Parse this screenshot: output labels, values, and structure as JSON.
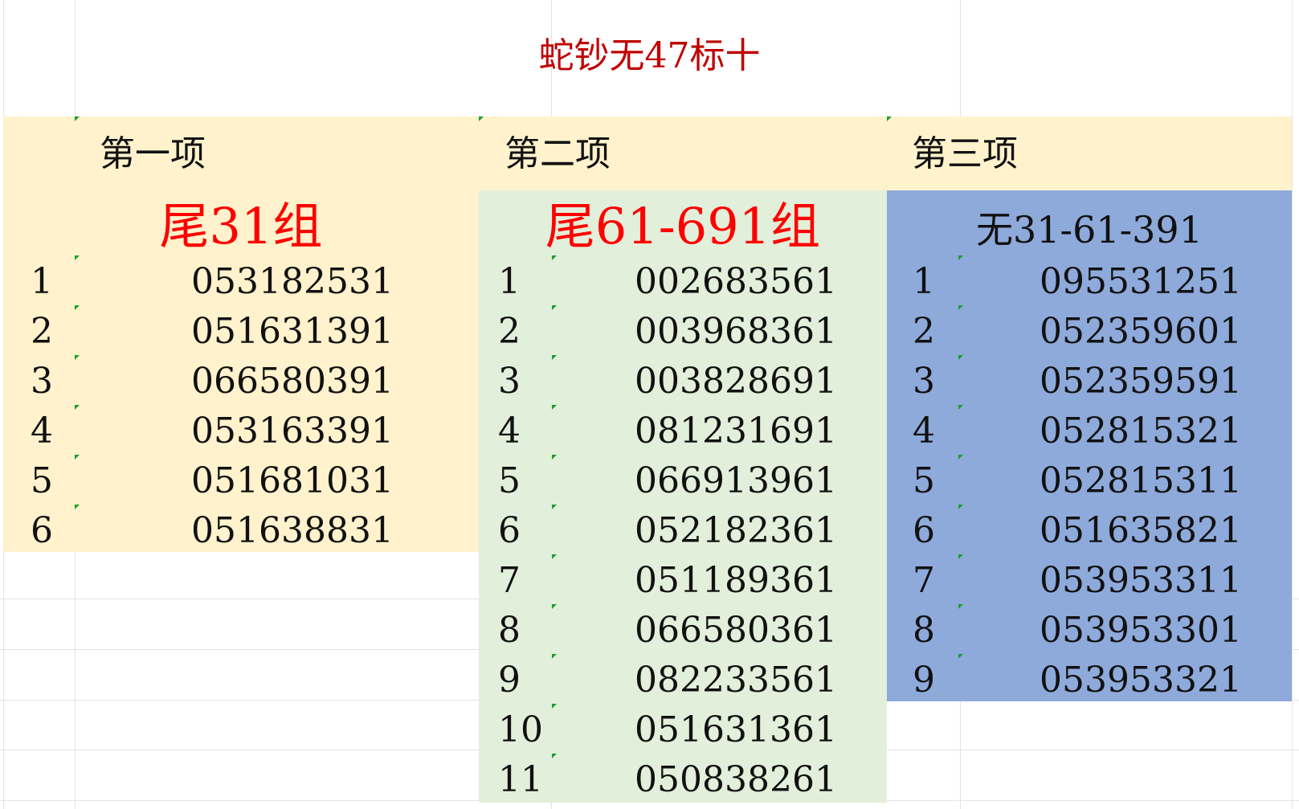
{
  "title": "蛇钞无47标十",
  "headers": [
    "第一项",
    "第二项",
    "第三项"
  ],
  "groups": [
    {
      "title": "尾31组",
      "rows": [
        {
          "idx": "1",
          "val": "053182531"
        },
        {
          "idx": "2",
          "val": "051631391"
        },
        {
          "idx": "3",
          "val": "066580391"
        },
        {
          "idx": "4",
          "val": "053163391"
        },
        {
          "idx": "5",
          "val": "051681031"
        },
        {
          "idx": "6",
          "val": "051638831"
        }
      ]
    },
    {
      "title": "尾61-691组",
      "rows": [
        {
          "idx": "1",
          "val": "002683561"
        },
        {
          "idx": "2",
          "val": "003968361"
        },
        {
          "idx": "3",
          "val": "003828691"
        },
        {
          "idx": "4",
          "val": "081231691"
        },
        {
          "idx": "5",
          "val": "066913961"
        },
        {
          "idx": "6",
          "val": "052182361"
        },
        {
          "idx": "7",
          "val": "051189361"
        },
        {
          "idx": "8",
          "val": "066580361"
        },
        {
          "idx": "9",
          "val": "082233561"
        },
        {
          "idx": "10",
          "val": "051631361"
        },
        {
          "idx": "11",
          "val": "050838261"
        }
      ]
    },
    {
      "title": "无31-61-391",
      "rows": [
        {
          "idx": "1",
          "val": "095531251"
        },
        {
          "idx": "2",
          "val": "052359601"
        },
        {
          "idx": "3",
          "val": "052359591"
        },
        {
          "idx": "4",
          "val": "052815321"
        },
        {
          "idx": "5",
          "val": "052815311"
        },
        {
          "idx": "6",
          "val": "051635821"
        },
        {
          "idx": "7",
          "val": "053953311"
        },
        {
          "idx": "8",
          "val": "053953301"
        },
        {
          "idx": "9",
          "val": "053953321"
        }
      ]
    }
  ],
  "colors": {
    "title": "#c00000",
    "group_title": "#ff0000",
    "header_band": "#fff2cc",
    "col1": "#fff2cc",
    "col2": "#e2efda",
    "col3": "#8eaadb",
    "tick": "#1a9e2f"
  }
}
